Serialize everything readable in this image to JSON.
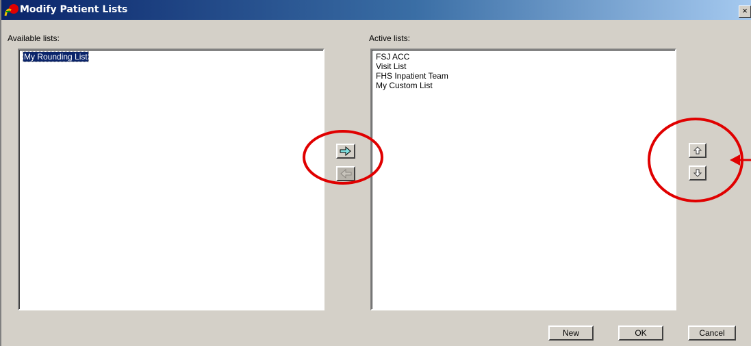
{
  "window": {
    "title": "Modify Patient Lists",
    "close_label": "×"
  },
  "available": {
    "label": "Available lists:",
    "items": [
      "My Rounding List"
    ],
    "selected_index": 0
  },
  "active": {
    "label": "Active lists:",
    "items": [
      "FSJ ACC",
      "Visit List",
      "FHS Inpatient Team",
      "My Custom List"
    ]
  },
  "buttons": {
    "new": "New",
    "ok": "OK",
    "cancel": "Cancel"
  },
  "icons": {
    "add": "arrow-right-icon",
    "remove": "arrow-left-icon",
    "up": "arrow-up-icon",
    "down": "arrow-down-icon"
  },
  "colors": {
    "annotation": "#e00000",
    "title_start": "#0a246a",
    "title_end": "#a6caf0",
    "arrow_fill": "#7fe0e0"
  }
}
